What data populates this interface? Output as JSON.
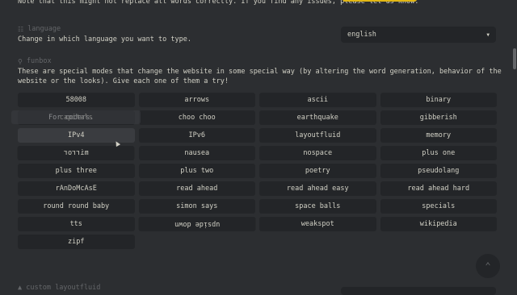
{
  "top_note": "Note that this might not replace all words correctly. If you find any issues, please let us know.",
  "colors": {
    "background": "#2c2e31",
    "text": "#d1d0c5",
    "sub": "#646669",
    "accent": "#e2b714",
    "button_bg": "#232528"
  },
  "language": {
    "icon": "language-icon",
    "title": "language",
    "description": "Change in which language you want to type.",
    "selected": "english"
  },
  "funbox": {
    "icon": "gamepad-icon",
    "title": "funbox",
    "description_line1": "These are special modes that change the website in some special way (by altering the word generation, behavior of the",
    "description_line2": "website or the looks). Give each one of them a try!",
    "tooltip": "For coders.",
    "options": [
      "58008",
      "arrows",
      "ascii",
      "binary",
      "capitals",
      "choo choo",
      "earthquake",
      "gibberish",
      "IPv4",
      "IPv6",
      "layoutfluid",
      "memory",
      "mirror",
      "nausea",
      "nospace",
      "plus one",
      "plus three",
      "plus two",
      "poetry",
      "pseudolang",
      "rAnDoMcAsE",
      "read ahead",
      "read ahead easy",
      "read ahead hard",
      "round round baby",
      "simon says",
      "space balls",
      "specials",
      "tts",
      "upside down",
      "weakspot",
      "wikipedia",
      "zipf"
    ]
  },
  "custom_layoutfluid": {
    "title": "custom layoutfluid"
  },
  "scroll_to_top": {
    "icon": "chevron-double-up-icon"
  }
}
